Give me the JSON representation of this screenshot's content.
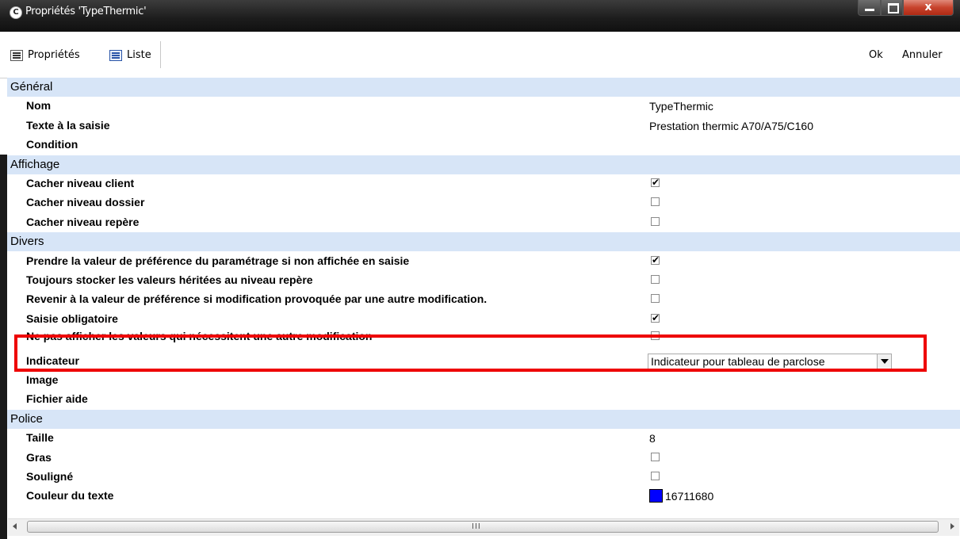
{
  "window": {
    "title": "Propriétés 'TypeThermic'",
    "app_icon": "C",
    "close_label": "x"
  },
  "toolbar": {
    "properties_label": "Propriétés",
    "list_label": "Liste",
    "ok_label": "Ok",
    "cancel_label": "Annuler"
  },
  "rows": [
    {
      "type": "category",
      "label": "Général"
    },
    {
      "type": "text",
      "label": "Nom",
      "value": "TypeThermic"
    },
    {
      "type": "text",
      "label": "Texte à la saisie",
      "value": "Prestation thermic A70/A75/C160"
    },
    {
      "type": "text",
      "label": "Condition",
      "value": ""
    },
    {
      "type": "category",
      "label": "Affichage"
    },
    {
      "type": "checkbox",
      "label": "Cacher niveau client",
      "checked": true
    },
    {
      "type": "checkbox",
      "label": "Cacher niveau dossier",
      "checked": false
    },
    {
      "type": "checkbox",
      "label": "Cacher niveau repère",
      "checked": false
    },
    {
      "type": "category",
      "label": "Divers"
    },
    {
      "type": "checkbox",
      "label": "Prendre la valeur de préférence du paramétrage si non affichée en saisie",
      "checked": true
    },
    {
      "type": "checkbox",
      "label": "Toujours stocker les valeurs héritées au niveau repère",
      "checked": false
    },
    {
      "type": "checkbox",
      "label": "Revenir à la valeur de préférence si modification provoquée par une autre modification.",
      "checked": false
    },
    {
      "type": "checkbox",
      "label": "Saisie obligatoire",
      "checked": true
    },
    {
      "type": "checkbox",
      "label": "Ne pas afficher les valeurs qui nécessitent une autre modification",
      "checked": false
    },
    {
      "type": "dropdown",
      "label": "Indicateur",
      "value": "Indicateur pour tableau de parclose"
    },
    {
      "type": "text",
      "label": "Image",
      "value": ""
    },
    {
      "type": "text",
      "label": "Fichier aide",
      "value": ""
    },
    {
      "type": "category",
      "label": "Police"
    },
    {
      "type": "text",
      "label": "Taille",
      "value": "8"
    },
    {
      "type": "checkbox",
      "label": "Gras",
      "checked": false
    },
    {
      "type": "checkbox",
      "label": "Souligné",
      "checked": false
    },
    {
      "type": "color",
      "label": "Couleur du texte",
      "value": "16711680",
      "color": "#0000ff"
    }
  ],
  "scrollbar": {
    "grip": "III"
  },
  "colors": {
    "category_bg": "#d7e5f7",
    "highlight": "#ee0000"
  }
}
